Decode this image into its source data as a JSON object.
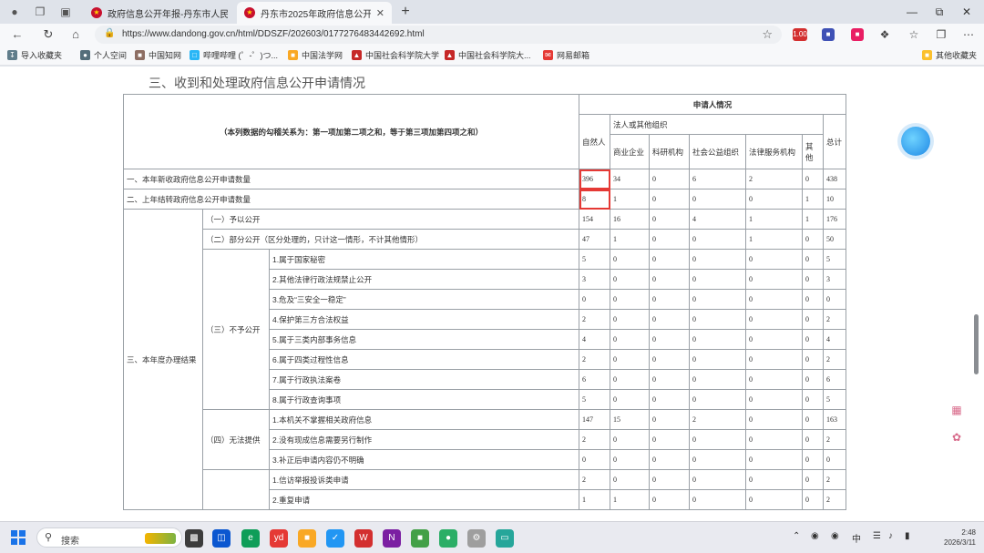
{
  "browser": {
    "tabs": [
      {
        "label": "政府信息公开年报-丹东市人民政府",
        "active": false
      },
      {
        "label": "丹东市2025年政府信息公开工作年",
        "active": true
      }
    ],
    "url": "https://www.dandong.gov.cn/html/DDSZF/202603/0177276483442692.html",
    "ext_badge": "1.00"
  },
  "bookmarks": {
    "import": "导入收藏夹",
    "items": [
      "个人空间",
      "中国知网",
      "哔哩哔哩 (゜-゜)つ...",
      "中国法学网",
      "中国社会科学院大学",
      "中国社会科学院大...",
      "网易邮箱"
    ],
    "other": "其他收藏夹"
  },
  "page": {
    "section_title": "三、收到和处理政府信息公开申请情况",
    "header": {
      "note": "（本列数据的勾稽关系为：第一项加第二项之和，等于第三项加第四项之和）",
      "applicant": "申请人情况",
      "natural": "自然人",
      "legal_group": "法人或其他组织",
      "sub": [
        "商业企业",
        "科研机构",
        "社会公益组织",
        "法律服务机构",
        "其他"
      ],
      "total": "总计"
    },
    "row_new": {
      "label": "一、本年新收政府信息公开申请数量",
      "values": [
        "396",
        "34",
        "0",
        "6",
        "2",
        "0",
        "438"
      ]
    },
    "row_prev": {
      "label": "二、上年结转政府信息公开申请数量",
      "values": [
        "8",
        "1",
        "0",
        "0",
        "0",
        "1",
        "10"
      ]
    },
    "results_label": "三、本年度办理结果",
    "open_full": {
      "label": "（一）予以公开",
      "values": [
        "154",
        "16",
        "0",
        "4",
        "1",
        "1",
        "176"
      ]
    },
    "open_partial": {
      "label": "（二）部分公开（区分处理的，只计这一情形，不计其他情形）",
      "values": [
        "47",
        "1",
        "0",
        "0",
        "1",
        "0",
        "50"
      ]
    },
    "not_open": {
      "label": "（三）不予公开",
      "rows": [
        {
          "label": "1.属于国家秘密",
          "values": [
            "5",
            "0",
            "0",
            "0",
            "0",
            "0",
            "5"
          ]
        },
        {
          "label": "2.其他法律行政法规禁止公开",
          "values": [
            "3",
            "0",
            "0",
            "0",
            "0",
            "0",
            "3"
          ]
        },
        {
          "label": "3.危及“三安全一稳定”",
          "values": [
            "0",
            "0",
            "0",
            "0",
            "0",
            "0",
            "0"
          ]
        },
        {
          "label": "4.保护第三方合法权益",
          "values": [
            "2",
            "0",
            "0",
            "0",
            "0",
            "0",
            "2"
          ]
        },
        {
          "label": "5.属于三类内部事务信息",
          "values": [
            "4",
            "0",
            "0",
            "0",
            "0",
            "0",
            "4"
          ]
        },
        {
          "label": "6.属于四类过程性信息",
          "values": [
            "2",
            "0",
            "0",
            "0",
            "0",
            "0",
            "2"
          ]
        },
        {
          "label": "7.属于行政执法案卷",
          "values": [
            "6",
            "0",
            "0",
            "0",
            "0",
            "0",
            "6"
          ]
        },
        {
          "label": "8.属于行政查询事项",
          "values": [
            "5",
            "0",
            "0",
            "0",
            "0",
            "0",
            "5"
          ]
        }
      ]
    },
    "cannot_provide": {
      "label": "（四）无法提供",
      "rows": [
        {
          "label": "1.本机关不掌握相关政府信息",
          "values": [
            "147",
            "15",
            "0",
            "2",
            "0",
            "0",
            "163"
          ]
        },
        {
          "label": "2.没有现成信息需要另行制作",
          "values": [
            "2",
            "0",
            "0",
            "0",
            "0",
            "0",
            "2"
          ]
        },
        {
          "label": "3.补正后申请内容仍不明确",
          "values": [
            "0",
            "0",
            "0",
            "0",
            "0",
            "0",
            "0"
          ]
        }
      ]
    },
    "not_processed": {
      "rows": [
        {
          "label": "1.信访举报投诉类申请",
          "values": [
            "2",
            "0",
            "0",
            "0",
            "0",
            "0",
            "2"
          ]
        },
        {
          "label": "2.重复申请",
          "values": [
            "1",
            "1",
            "0",
            "0",
            "0",
            "0",
            "2"
          ]
        }
      ]
    }
  },
  "taskbar": {
    "search_placeholder": "搜索",
    "ime": "中",
    "time": "2:48",
    "date": "2026/3/11"
  }
}
